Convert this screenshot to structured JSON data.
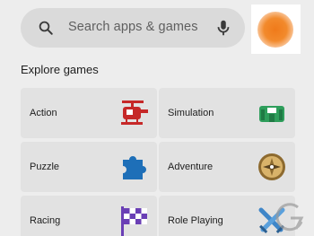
{
  "search": {
    "placeholder": "Search apps & games"
  },
  "icons": {
    "search": "search-icon",
    "mic": "mic-icon",
    "avatar": "avatar"
  },
  "section": {
    "title": "Explore games"
  },
  "categories": [
    {
      "label": "Action",
      "icon": "helicopter-icon",
      "color": "#c62828"
    },
    {
      "label": "Simulation",
      "icon": "stadium-icon",
      "color": "#2e9e5b"
    },
    {
      "label": "Puzzle",
      "icon": "puzzle-piece-icon",
      "color": "#1e6fb8"
    },
    {
      "label": "Adventure",
      "icon": "compass-icon",
      "color": "#8d6a2f"
    },
    {
      "label": "Racing",
      "icon": "checkered-flag-icon",
      "color": "#6a3fb5"
    },
    {
      "label": "Role Playing",
      "icon": "crossed-swords-icon",
      "color": "#3f86c8"
    }
  ],
  "colors": {
    "background": "#ededed",
    "tile": "#e2e2e2",
    "search_bar": "#dadada",
    "avatar": "#f07a1a"
  }
}
